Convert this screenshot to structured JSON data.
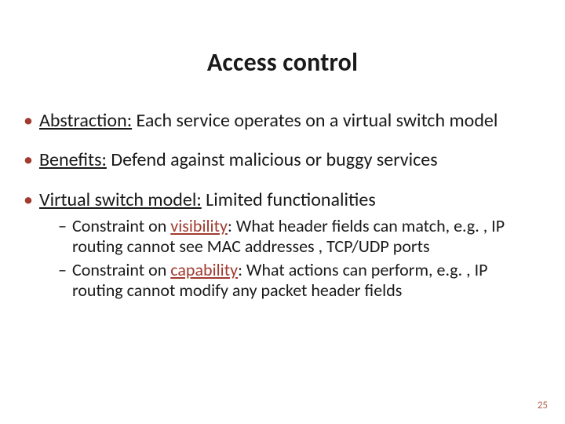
{
  "title": "Access control",
  "bullets": [
    {
      "lead": "Abstraction:",
      "rest": " Each service operates on a virtual switch model"
    },
    {
      "lead": "Benefits:",
      "rest": " Defend against malicious or buggy services"
    },
    {
      "lead": "Virtual switch model:",
      "rest": " Limited functionalities",
      "sub": [
        {
          "prefix": "Constraint on ",
          "keyword": "visibility",
          "suffix": ": What header fields can match, e.g. , IP routing cannot see MAC addresses , TCP/UDP ports"
        },
        {
          "prefix": "Constraint on ",
          "keyword": "capability",
          "suffix": ": What actions can perform, e.g. , IP routing cannot modify any packet header fields"
        }
      ]
    }
  ],
  "page_number": "25"
}
